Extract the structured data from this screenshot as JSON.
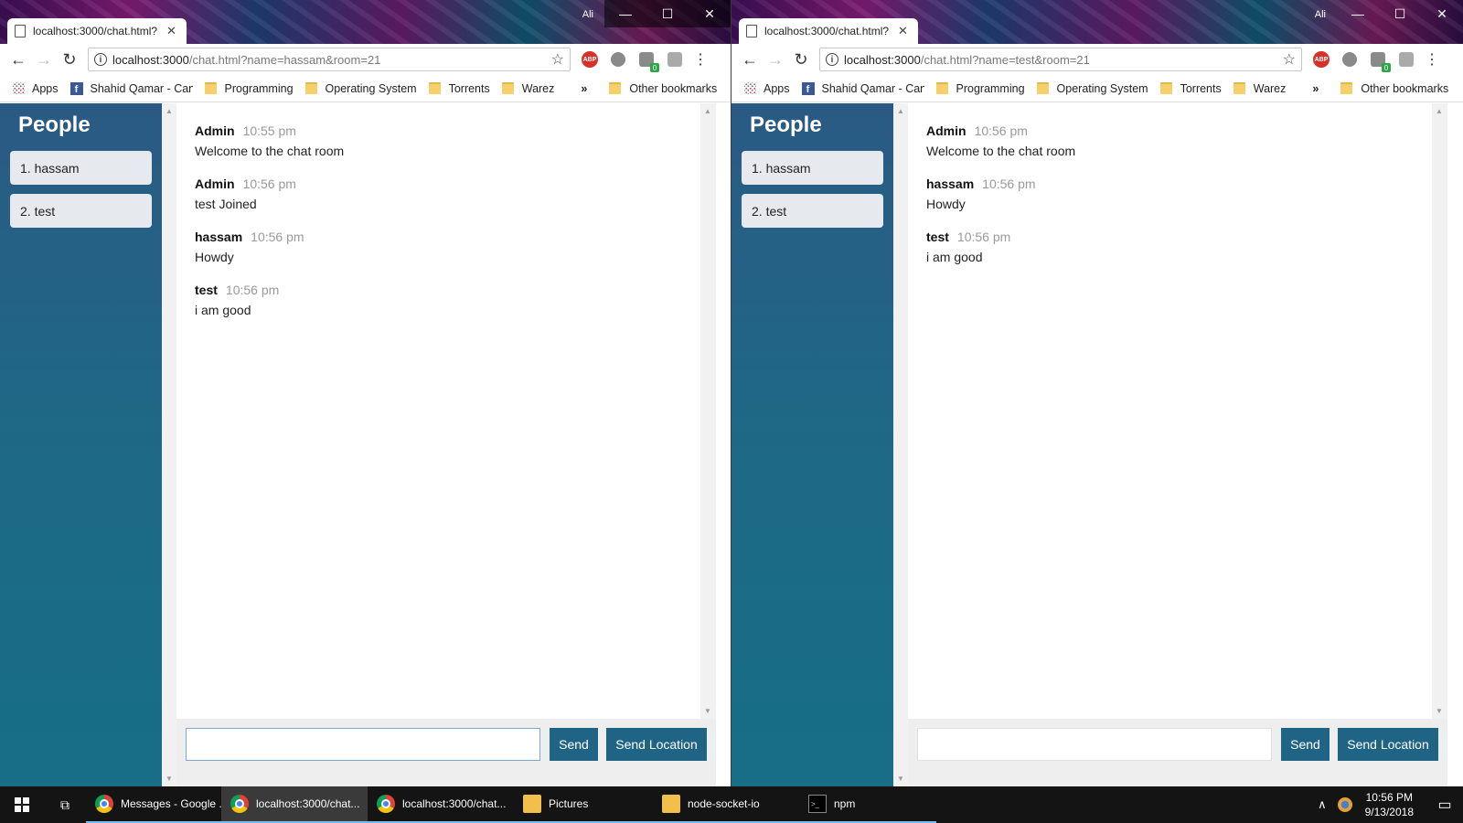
{
  "windows": [
    {
      "tab_title": "localhost:3000/chat.html?",
      "profile": "Ali",
      "url_host": "localhost:3000",
      "url_path": "/chat.html?name=hassam&room=21",
      "messages": [
        {
          "user": "Admin",
          "time": "10:55 pm",
          "text": "Welcome to the chat room"
        },
        {
          "user": "Admin",
          "time": "10:56 pm",
          "text": "test Joined"
        },
        {
          "user": "hassam",
          "time": "10:56 pm",
          "text": "Howdy"
        },
        {
          "user": "test",
          "time": "10:56 pm",
          "text": "i am good"
        }
      ],
      "input_value": ""
    },
    {
      "tab_title": "localhost:3000/chat.html?",
      "profile": "Ali",
      "url_host": "localhost:3000",
      "url_path": "/chat.html?name=test&room=21",
      "messages": [
        {
          "user": "Admin",
          "time": "10:56 pm",
          "text": "Welcome to the chat room"
        },
        {
          "user": "hassam",
          "time": "10:56 pm",
          "text": "Howdy"
        },
        {
          "user": "test",
          "time": "10:56 pm",
          "text": "i am good"
        }
      ],
      "input_value": ""
    }
  ],
  "bookmarks": {
    "apps": "Apps",
    "items": [
      "Shahid Qamar - Cana",
      "Programming",
      "Operating System",
      "Torrents",
      "Warez"
    ],
    "more": "»",
    "other": "Other bookmarks"
  },
  "sidebar": {
    "title": "People",
    "people": [
      "1. hassam",
      "2. test"
    ]
  },
  "buttons": {
    "send": "Send",
    "send_location": "Send Location"
  },
  "extensions": {
    "abp": "ABP",
    "badge": "0"
  },
  "taskbar": {
    "items": [
      {
        "label": "Messages - Google ...",
        "icon": "chrome-icon"
      },
      {
        "label": "localhost:3000/chat...",
        "icon": "chrome-icon"
      },
      {
        "label": "localhost:3000/chat...",
        "icon": "chrome-icon"
      },
      {
        "label": "Pictures",
        "icon": "folder-icon"
      },
      {
        "label": "node-socket-io",
        "icon": "folder-icon"
      },
      {
        "label": "npm",
        "icon": "cmd-icon"
      }
    ],
    "time": "10:56 PM",
    "date": "9/13/2018"
  },
  "colors": {
    "sidebar": "#1f6485",
    "button": "#1f6485",
    "person_item": "#e6e9ed"
  }
}
